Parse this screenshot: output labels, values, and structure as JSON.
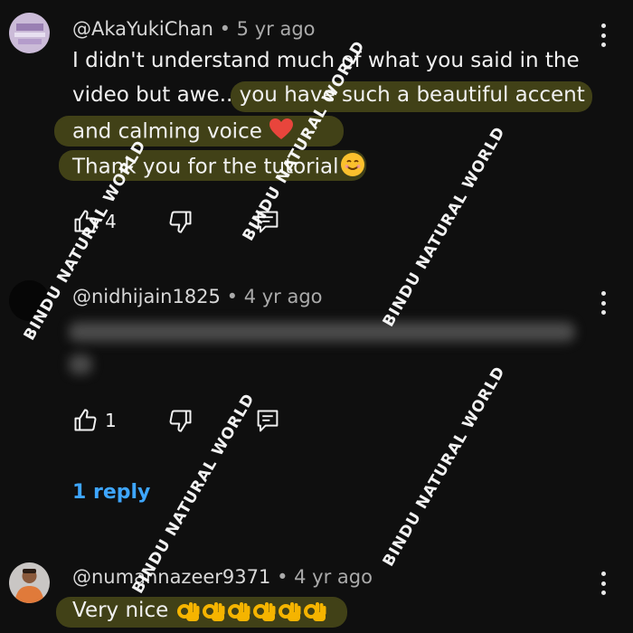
{
  "comments": [
    {
      "author": "@AkaYukiChan",
      "age": "5 yr ago",
      "lines": [
        "I didn't understand much of what you said in the",
        "video but awe.. you have such a beautiful accent",
        "and calming voice",
        "Thank you for the tutorial"
      ],
      "likes": "4"
    },
    {
      "author": "@nidhijain1825",
      "age": "4 yr ago",
      "likes": "1",
      "replies_label": "1 reply"
    },
    {
      "author": "@numannazeer9371",
      "age": "4 yr ago",
      "text": "Very nice"
    }
  ],
  "watermark": "BINDU NATURAL WORLD",
  "separator": "•",
  "icons": {
    "like": "thumbs-up-icon",
    "dislike": "thumbs-down-icon",
    "reply": "reply-icon",
    "more": "more-vertical-icon",
    "heart": "red-heart-emoji",
    "smile": "smiling-face-emoji",
    "ok": "ok-hand-emoji"
  },
  "colors": {
    "background": "#0f0f0f",
    "text": "#f1f1f1",
    "meta": "#aaaaaa",
    "link": "#3ea6ff",
    "highlight": "#6b6b1a"
  }
}
